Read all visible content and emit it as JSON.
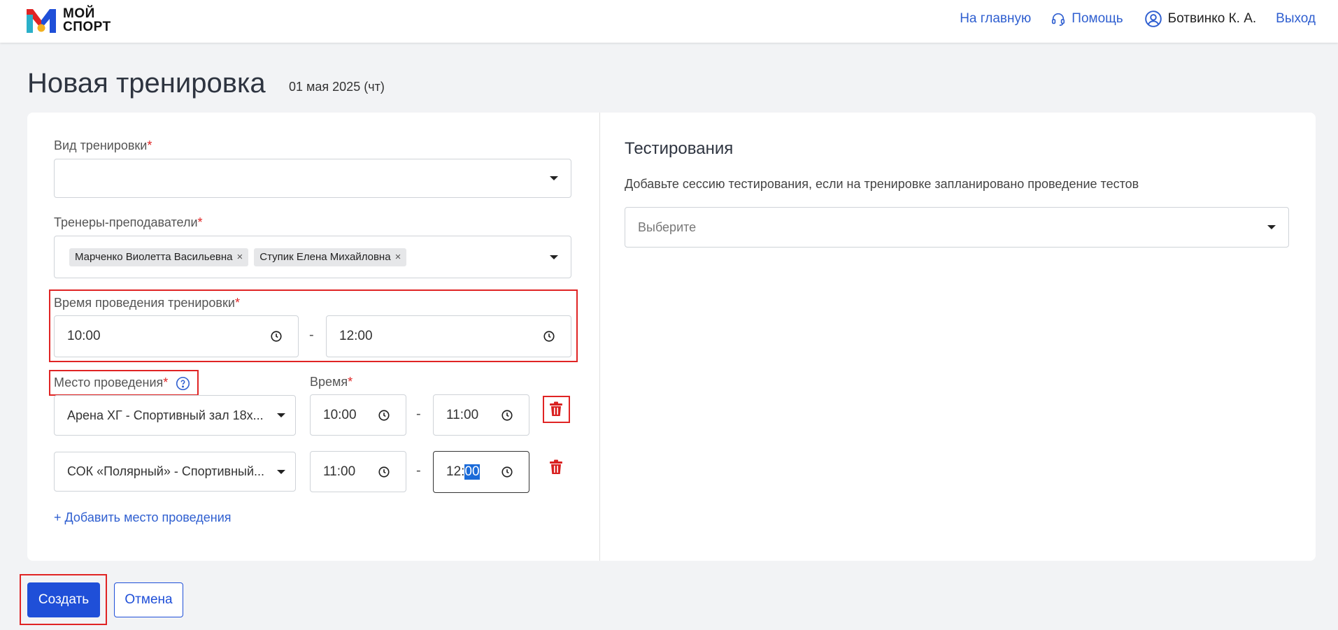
{
  "header": {
    "logo_line1": "МОЙ",
    "logo_line2": "СПОРТ",
    "nav_home": "На главную",
    "nav_help": "Помощь",
    "user_name": "Ботвинко К. А.",
    "nav_logout": "Выход"
  },
  "page": {
    "title": "Новая тренировка",
    "date": "01 мая 2025 (чт)"
  },
  "form": {
    "training_type_label": "Вид тренировки",
    "training_type_value": "",
    "coaches_label": "Тренеры-преподаватели",
    "coaches": [
      "Марченко Виолетта Васильевна",
      "Ступик Елена Михайловна"
    ],
    "chip_remove": "×",
    "required_mark": "*",
    "time_label": "Время проведения тренировки",
    "time_start": "10:00",
    "time_end": "12:00",
    "dash": "-",
    "venue_label": "Место проведения",
    "venue_time_label": "Время",
    "venues": [
      {
        "name": "Арена ХГ - Спортивный зал 18х...",
        "start": "10:00",
        "end": "11:00"
      },
      {
        "name": "СОК «Полярный» - Спортивный...",
        "start": "11:00",
        "end_hour": "12:",
        "end_min": "00"
      }
    ],
    "add_venue": "+ Добавить место проведения"
  },
  "testing": {
    "title": "Тестирования",
    "description": "Добавьте сессию тестирования, если на тренировке запланировано проведение тестов",
    "select_placeholder": "Выберите"
  },
  "actions": {
    "create": "Создать",
    "cancel": "Отмена"
  },
  "colors": {
    "accent": "#2f5fd0",
    "primary_button": "#1f4fd8",
    "required": "#e02424",
    "highlight": "#e02424"
  },
  "icons": {
    "help": "headset-icon",
    "user": "user-circle-icon",
    "clock": "clock-icon",
    "delete": "trash-icon",
    "question": "question-circle-icon"
  }
}
